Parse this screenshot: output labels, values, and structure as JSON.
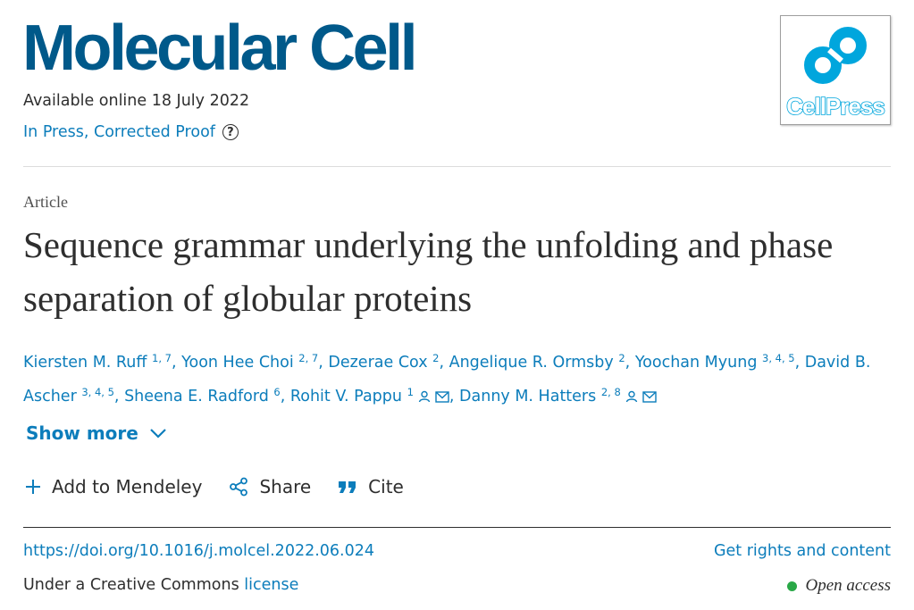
{
  "journal": {
    "title": "Molecular Cell"
  },
  "logo": {
    "text": "CellPress",
    "color": "#00a6dd"
  },
  "availability": {
    "text": "Available online 18 July 2022"
  },
  "status": {
    "text": "In Press, Corrected Proof",
    "help_icon": "question-circle-icon"
  },
  "article": {
    "type": "Article",
    "title": "Sequence grammar underlying the unfolding and phase separation of globular proteins"
  },
  "authors": [
    {
      "name": "Kiersten M. Ruff",
      "sup": "1, 7"
    },
    {
      "name": "Yoon Hee Choi",
      "sup": "2, 7"
    },
    {
      "name": "Dezerae Cox",
      "sup": "2"
    },
    {
      "name": "Angelique R. Ormsby",
      "sup": "2"
    },
    {
      "name": "Yoochan Myung",
      "sup": "3, 4, 5"
    },
    {
      "name": "David B. Ascher",
      "sup": "3, 4, 5"
    },
    {
      "name": "Sheena E. Radford",
      "sup": "6"
    },
    {
      "name": "Rohit V. Pappu",
      "sup": "1"
    },
    {
      "name": "Danny M. Hatters",
      "sup": "2, 8"
    }
  ],
  "show_more": {
    "label": "Show more"
  },
  "actions": {
    "mendeley": "Add to Mendeley",
    "share": "Share",
    "cite": "Cite"
  },
  "doi": {
    "url": "https://doi.org/10.1016/j.molcel.2022.06.024"
  },
  "rights": {
    "label": "Get rights and content"
  },
  "license": {
    "prefix": "Under a Creative Commons ",
    "link": "license"
  },
  "open_access": {
    "label": "Open access",
    "color": "#29a847"
  },
  "colors": {
    "journal_blue": "#00598a",
    "link_blue": "#0c7dbb",
    "text": "#2e2e2e"
  }
}
